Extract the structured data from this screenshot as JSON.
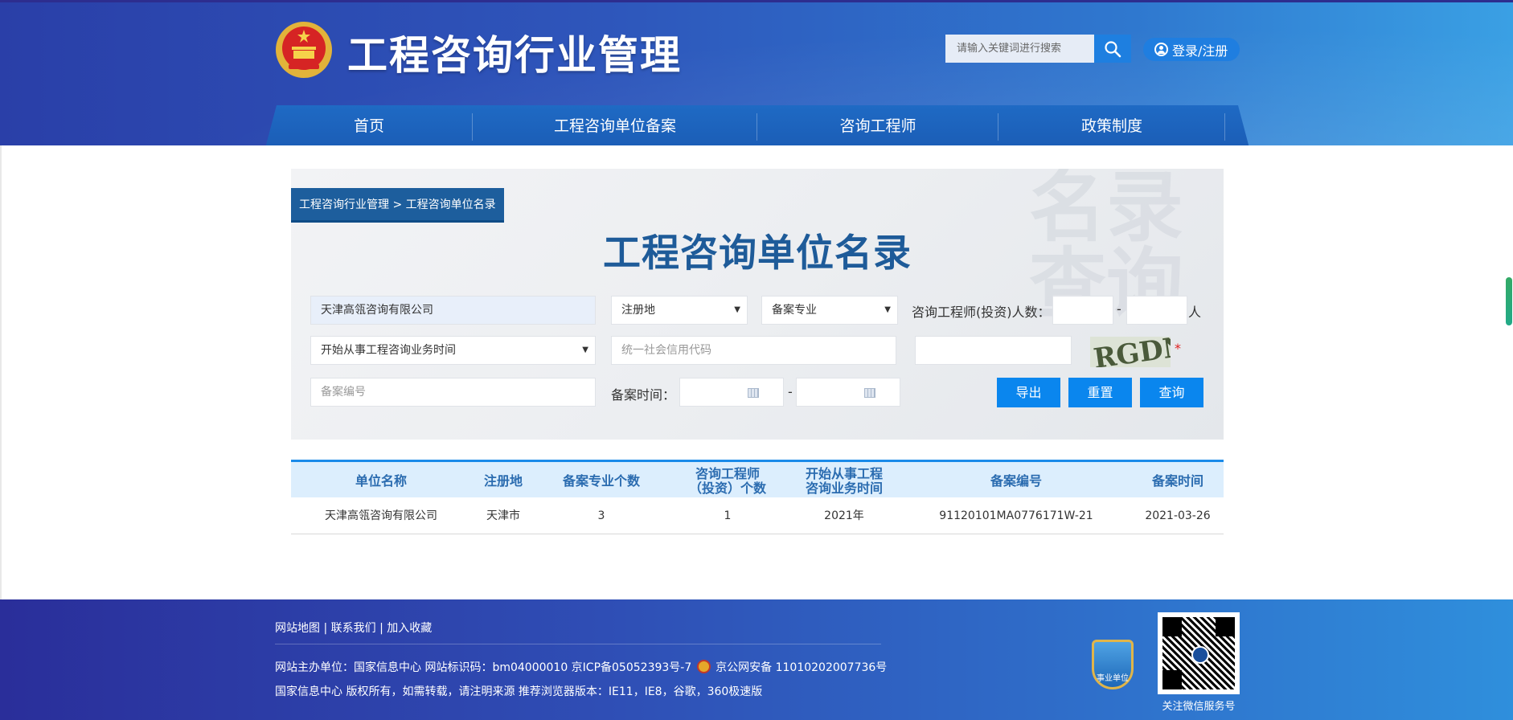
{
  "header": {
    "site_title": "工程咨询行业管理",
    "search_placeholder": "请输入关键词进行搜索",
    "login_label": "登录/注册",
    "nav": [
      "首页",
      "工程咨询单位备案",
      "咨询工程师",
      "政策制度"
    ]
  },
  "breadcrumb": "工程咨询行业管理 > 工程咨询单位名录",
  "page_title": "工程咨询单位名录",
  "watermark": [
    "名录",
    "查询"
  ],
  "filters": {
    "company_name_value": "天津高瓴咨询有限公司",
    "region_select": "注册地",
    "specialty_select": "备案专业",
    "engineer_count_label": "咨询工程师(投资)人数：",
    "range_sep": "-",
    "people_unit": "人",
    "start_time_select": "开始从事工程咨询业务时间",
    "credit_code_placeholder": "统一社会信用代码",
    "record_no_placeholder": "备案编号",
    "record_time_label": "备案时间：",
    "captcha_text": "RGDN",
    "required_star": "*"
  },
  "buttons": {
    "export": "导出",
    "reset": "重置",
    "query": "查询"
  },
  "table": {
    "columns": [
      "单位名称",
      "注册地",
      "备案专业个数",
      "咨询工程师\n（投资）个数",
      "开始从事工程\n咨询业务时间",
      "备案编号",
      "备案时间"
    ],
    "rows": [
      [
        "天津高瓴咨询有限公司",
        "天津市",
        "3",
        "1",
        "2021年",
        "91120101MA0776171W-21",
        "2021-03-26"
      ]
    ]
  },
  "footer": {
    "links": "网站地图 | 联系我们 | 加入收藏",
    "info_line1_a": "网站主办单位：国家信息中心    网站标识码：bm04000010    京ICP备05052393号-7",
    "info_line1_b": "京公网安备 11010202007736号",
    "info_line2": "国家信息中心 版权所有，如需转载，请注明来源    推荐浏览器版本：IE11，IE8，谷歌，360极速版",
    "badge_label": "事业单位",
    "qr_caption": "关注微信服务号"
  },
  "colors": {
    "brand_blue": "#1e5b99",
    "button_blue": "#0a86ee",
    "header_dark": "#2a3fa8"
  }
}
